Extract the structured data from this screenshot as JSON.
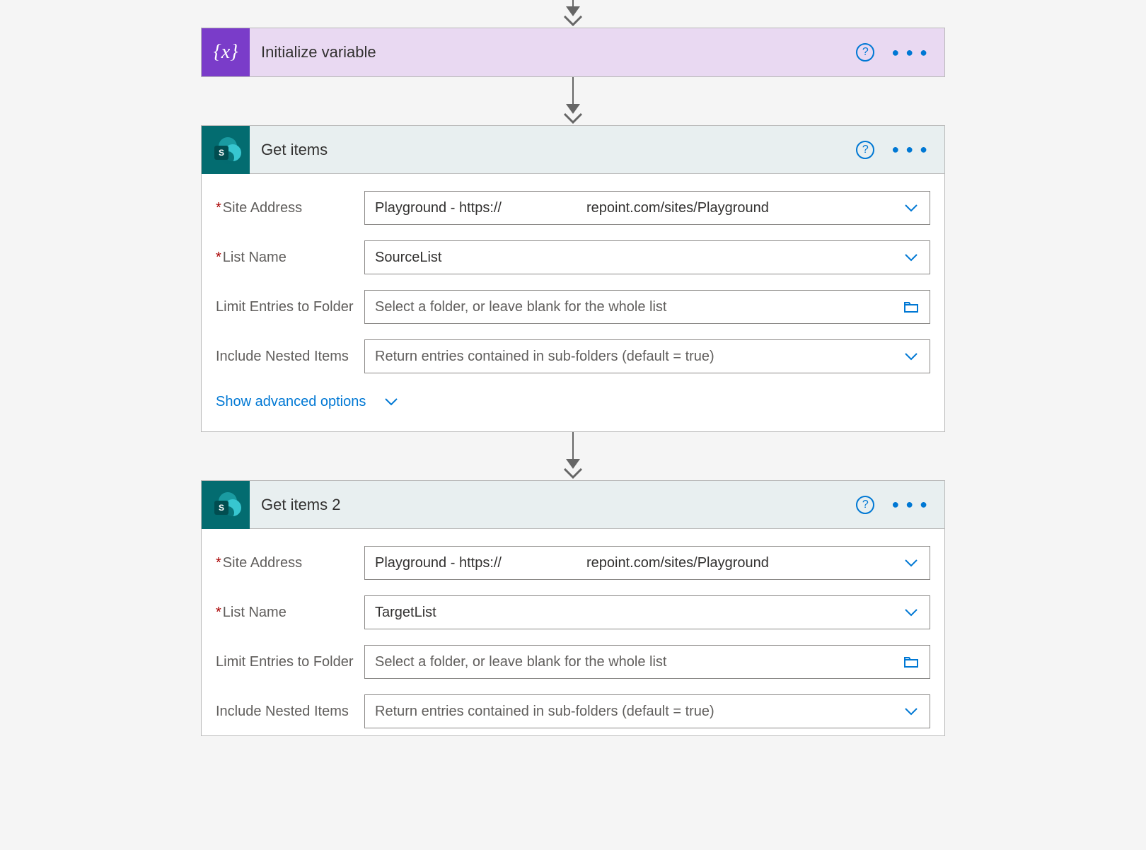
{
  "cards": {
    "init_var": {
      "title": "Initialize variable"
    },
    "get_items_1": {
      "title": "Get items",
      "fields": {
        "site_label": "Site Address",
        "site_value_a": "Playground - https://",
        "site_value_b": "repoint.com/sites/Playground",
        "list_label": "List Name",
        "list_value": "SourceList",
        "limit_label": "Limit Entries to Folder",
        "limit_placeholder": "Select a folder, or leave blank for the whole list",
        "nested_label": "Include Nested Items",
        "nested_placeholder": "Return entries contained in sub-folders (default = true)"
      },
      "advanced": "Show advanced options"
    },
    "get_items_2": {
      "title": "Get items 2",
      "fields": {
        "site_label": "Site Address",
        "site_value_a": "Playground - https://",
        "site_value_b": "repoint.com/sites/Playground",
        "list_label": "List Name",
        "list_value": "TargetList",
        "limit_label": "Limit Entries to Folder",
        "limit_placeholder": "Select a folder, or leave blank for the whole list",
        "nested_label": "Include Nested Items",
        "nested_placeholder": "Return entries contained in sub-folders (default = true)"
      }
    }
  },
  "icons": {
    "sp_letter": "S",
    "help": "?",
    "more": "● ● ●",
    "var": "{x}"
  }
}
